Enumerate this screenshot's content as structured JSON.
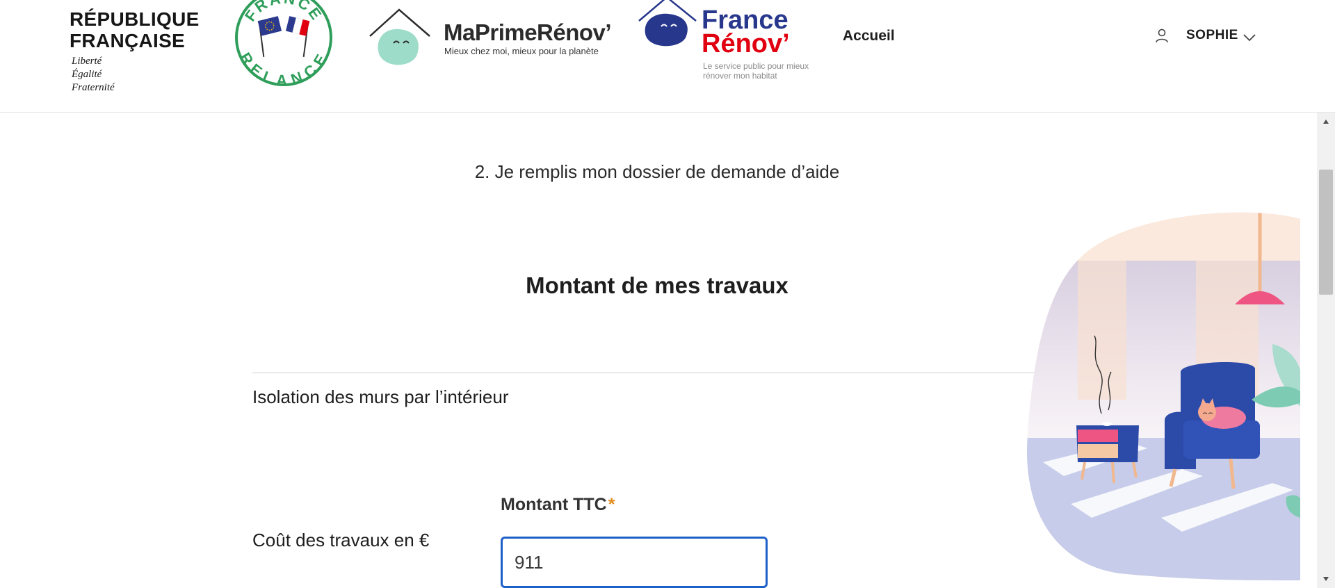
{
  "header": {
    "republique": {
      "title": "RÉPUBLIQUE\nFRANÇAISE",
      "motto": "Liberté\nÉgalité\nFraternité",
      "flag_colors": [
        "#000091",
        "#e1000f"
      ]
    },
    "france_relance": {
      "text_top": "FRANCE",
      "text_bottom": "RELANCE",
      "color": "#2f9e5a"
    },
    "maprimerenov": {
      "name": "MaPrimeRénov’",
      "tagline": "Mieux chez moi, mieux pour la planète",
      "mascot_color": "#9ddcc8"
    },
    "france_renov": {
      "line1": "France",
      "line2": "Rénov’",
      "tagline": "Le service public pour mieux\nrénover mon habitat",
      "colors": {
        "blue": "#27378c",
        "red": "#e1000f"
      }
    },
    "nav": {
      "home_label": "Accueil"
    },
    "user": {
      "name": "SOPHIE",
      "icon": "user-icon",
      "chevron": "chevron-down-icon"
    }
  },
  "main": {
    "step_title": "2. Je remplis mon dossier de demande d’aide",
    "section_title": "Montant de mes travaux",
    "work_item": "Isolation des murs par l’intérieur",
    "field": {
      "label": "Montant TTC",
      "required_marker": "*",
      "row_label": "Coût des travaux en €",
      "value": "911",
      "focus_color": "#1d61c8"
    }
  },
  "scrollbar": {
    "up_icon": "scroll-up-arrow-icon",
    "down_icon": "scroll-down-arrow-icon"
  }
}
